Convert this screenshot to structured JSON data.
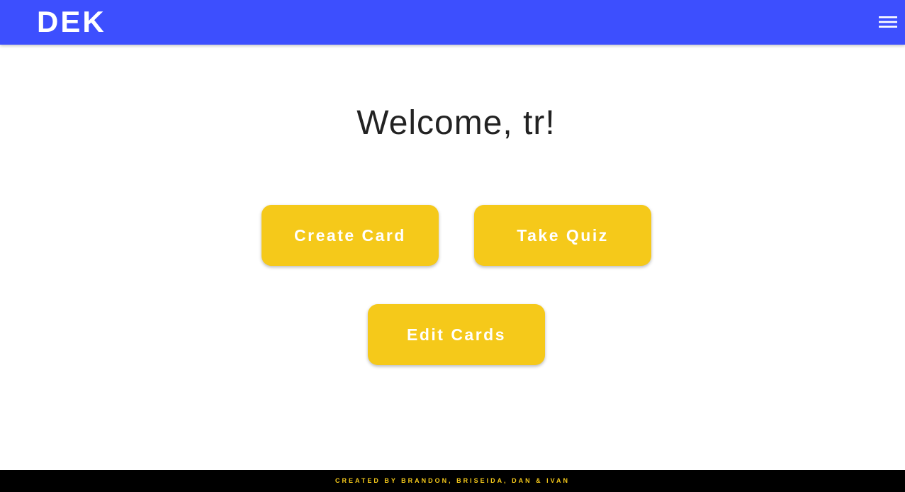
{
  "colors": {
    "brand_blue": "#3d4ffe",
    "button_yellow": "#f5c91a",
    "footer_bg": "#000000",
    "footer_text": "#f5c91a",
    "heading_text": "#222222"
  },
  "nav": {
    "logo": "DEK",
    "menu_icon": "hamburger-menu-icon"
  },
  "main": {
    "welcome": "Welcome, tr!",
    "buttons": {
      "create_card": "Create Card",
      "take_quiz": "Take Quiz",
      "edit_cards": "Edit Cards"
    }
  },
  "footer": {
    "credits": "CREATED BY BRANDON, BRISEIDA, DAN & IVAN"
  }
}
